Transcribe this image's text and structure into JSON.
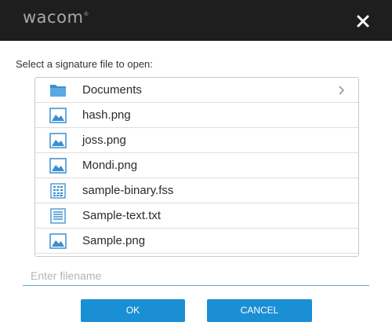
{
  "header": {
    "logo_text": "wacom",
    "logo_mark": "®",
    "close_icon": "close-icon"
  },
  "dialog": {
    "prompt": "Select a signature file to open:",
    "files": [
      {
        "label": "Documents",
        "icon": "folder-icon"
      },
      {
        "label": "hash.png",
        "icon": "image-file-icon"
      },
      {
        "label": "joss.png",
        "icon": "image-file-icon"
      },
      {
        "label": "Mondi.png",
        "icon": "image-file-icon"
      },
      {
        "label": "sample-binary.fss",
        "icon": "binary-file-icon"
      },
      {
        "label": "Sample-text.txt",
        "icon": "text-file-icon"
      },
      {
        "label": "Sample.png",
        "icon": "image-file-icon"
      }
    ],
    "filename_value": "",
    "filename_placeholder": "Enter filename",
    "ok_label": "OK",
    "cancel_label": "CANCEL"
  },
  "colors": {
    "titlebar": "#1e1e1e",
    "accent": "#1a8fd4",
    "icon_blue": "#3a8fd0"
  }
}
